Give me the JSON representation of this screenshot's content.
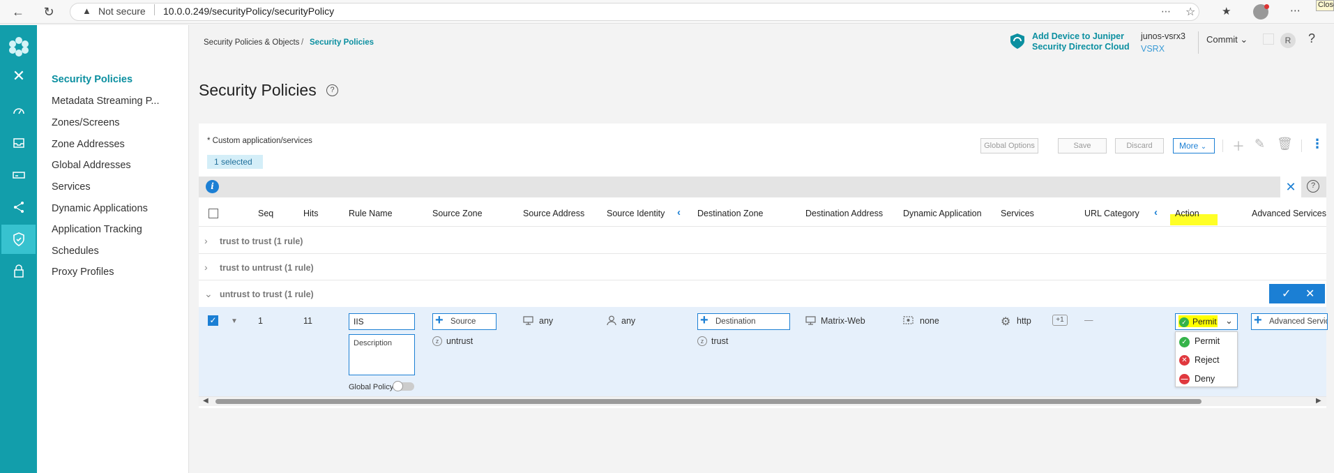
{
  "browser": {
    "back_icon": "back-arrow-icon",
    "reload_icon": "reload-icon",
    "security_warning": "Not secure",
    "url": "10.0.0.249/securityPolicy/securityPolicy",
    "tooltip": "Close"
  },
  "sidebar": {
    "items": [
      {
        "label": "Security Policies",
        "active": true
      },
      {
        "label": "Metadata Streaming P..."
      },
      {
        "label": "Zones/Screens"
      },
      {
        "label": "Zone Addresses"
      },
      {
        "label": "Global Addresses"
      },
      {
        "label": "Services"
      },
      {
        "label": "Dynamic Applications"
      },
      {
        "label": "Application Tracking"
      },
      {
        "label": "Schedules"
      },
      {
        "label": "Proxy Profiles"
      }
    ]
  },
  "header": {
    "breadcrumb_parent": "Security Policies & Objects",
    "breadcrumb_sep": "/",
    "breadcrumb_current": "Security Policies",
    "title": "Security Policies",
    "help": "?",
    "add_device_line1": "Add Device to Juniper",
    "add_device_line2": "Security Director Cloud",
    "device_name": "junos-vsrx3",
    "device_type": "VSRX",
    "commit": "Commit",
    "avatar": "R",
    "help_icon": "?"
  },
  "toolbar": {
    "note": "* Custom application/services",
    "selected": "1 selected",
    "global_options": "Global Options",
    "save": "Save",
    "discard": "Discard",
    "more": "More"
  },
  "info": {
    "icon": "i"
  },
  "columns": {
    "seq": "Seq",
    "hits": "Hits",
    "rule_name": "Rule Name",
    "source_zone": "Source Zone",
    "source_address": "Source Address",
    "source_identity": "Source Identity",
    "destination_zone": "Destination Zone",
    "destination_address": "Destination Address",
    "dynamic_application": "Dynamic Application",
    "services": "Services",
    "url_category": "URL Category",
    "action": "Action",
    "advanced_services": "Advanced Services"
  },
  "groups": [
    {
      "label": "trust to trust (1 rule)",
      "expanded": false
    },
    {
      "label": "trust to untrust (1 rule)",
      "expanded": false
    },
    {
      "label": "untrust to trust (1 rule)",
      "expanded": true
    }
  ],
  "rule": {
    "seq": "1",
    "hits": "11",
    "name": "IIS",
    "description_placeholder": "Description",
    "global_policy": "Global Policy",
    "source_button": "Source",
    "source_zone": "untrust",
    "source_address": "any",
    "source_identity": "any",
    "destination_button": "Destination",
    "destination_zone": "trust",
    "destination_address": "Matrix-Web",
    "dynamic_application": "none",
    "service": "http",
    "service_more": "+1",
    "url_category": "—",
    "action": "Permit",
    "advanced_services": "Advanced Servic"
  },
  "action_menu": [
    {
      "label": "Permit",
      "color": "#35b34a",
      "icon": "check-circle-icon"
    },
    {
      "label": "Reject",
      "color": "#e0383e",
      "icon": "x-circle-icon"
    },
    {
      "label": "Deny",
      "color": "#e0383e",
      "icon": "minus-circle-icon"
    }
  ],
  "colors": {
    "brand": "#129eab",
    "accent": "#1b7fd4",
    "highlight": "#ffff00"
  }
}
